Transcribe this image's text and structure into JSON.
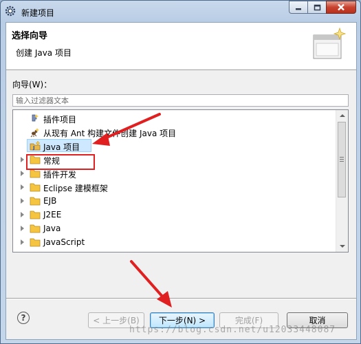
{
  "window": {
    "title": "新建项目"
  },
  "header": {
    "title": "选择向导",
    "subtitle": "创建 Java 项目"
  },
  "wizards": {
    "label": "向导(W)：",
    "filter_placeholder": "输入过滤器文本",
    "items": [
      {
        "label": "插件项目",
        "icon": "plugin-project-icon",
        "expandable": false
      },
      {
        "label": "从现有 Ant 构建文件创建 Java 项目",
        "icon": "ant-project-icon",
        "expandable": false
      },
      {
        "label": "Java 项目",
        "icon": "java-project-icon",
        "expandable": false,
        "selected": true
      },
      {
        "label": "常规",
        "icon": "folder-icon",
        "expandable": true
      },
      {
        "label": "插件开发",
        "icon": "folder-icon",
        "expandable": true
      },
      {
        "label": "Eclipse 建模框架",
        "icon": "folder-icon",
        "expandable": true
      },
      {
        "label": "EJB",
        "icon": "folder-icon",
        "expandable": true
      },
      {
        "label": "J2EE",
        "icon": "folder-icon",
        "expandable": true
      },
      {
        "label": "Java",
        "icon": "folder-icon",
        "expandable": true
      },
      {
        "label": "JavaScript",
        "icon": "folder-icon",
        "expandable": true
      }
    ]
  },
  "buttons": {
    "back": "< 上一步(B)",
    "next": "下一步(N) >",
    "finish": "完成(F)",
    "cancel": "取消"
  },
  "watermark": "https://blog.csdn.net/u12033448087",
  "colors": {
    "annotation": "#e02020",
    "selection": "#cde8ff",
    "folder": "#f5c542"
  }
}
